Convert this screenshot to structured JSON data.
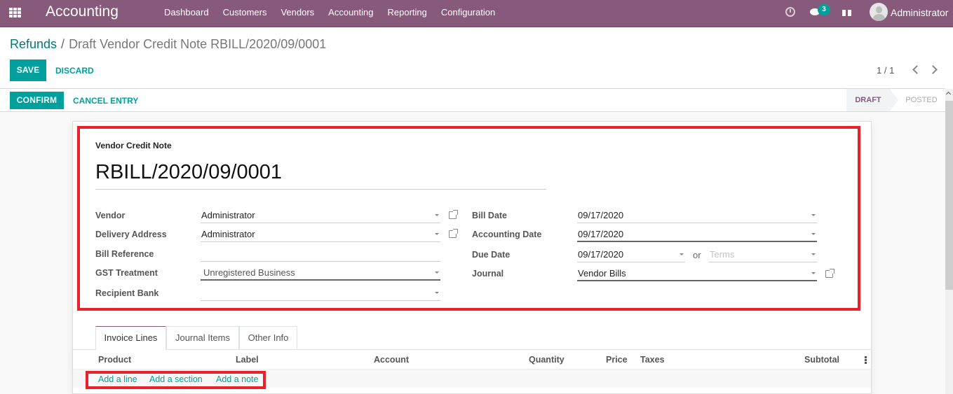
{
  "navbar": {
    "app_title": "Accounting",
    "menu": [
      "Dashboard",
      "Customers",
      "Vendors",
      "Accounting",
      "Reporting",
      "Configuration"
    ],
    "messages_badge": "3",
    "user_name": "Administrator",
    "bg_color": "#875a7b"
  },
  "control_panel": {
    "breadcrumb_parent": "Refunds",
    "breadcrumb_separator": "/",
    "breadcrumb_current": "Draft Vendor Credit Note RBILL/2020/09/0001",
    "save_label": "SAVE",
    "discard_label": "DISCARD",
    "pager_value": "1 / 1"
  },
  "header_buttons": {
    "confirm_label": "CONFIRM",
    "cancel_entry_label": "CANCEL ENTRY"
  },
  "statusbar": {
    "states": [
      "DRAFT",
      "POSTED"
    ],
    "current": "DRAFT"
  },
  "form": {
    "doc_type": "Vendor Credit Note",
    "doc_name": "RBILL/2020/09/0001",
    "left_fields": [
      {
        "label": "Vendor",
        "value": "Administrator"
      },
      {
        "label": "Delivery Address",
        "value": "Administrator"
      },
      {
        "label": "Bill Reference",
        "value": ""
      },
      {
        "label": "GST Treatment",
        "value": "Unregistered Business"
      },
      {
        "label": "Recipient Bank",
        "value": ""
      }
    ],
    "right_fields": [
      {
        "label": "Bill Date",
        "value": "09/17/2020"
      },
      {
        "label": "Accounting Date",
        "value": "09/17/2020"
      },
      {
        "label": "Due Date",
        "value": "09/17/2020"
      },
      {
        "label": "Journal",
        "value": "Vendor Bills"
      }
    ],
    "due_date_or": "or",
    "terms_placeholder": "Terms"
  },
  "tabs": [
    "Invoice Lines",
    "Journal Items",
    "Other Info"
  ],
  "active_tab": "Invoice Lines",
  "invoice_lines": {
    "columns": [
      "Product",
      "Label",
      "Account",
      "Quantity",
      "Price",
      "Taxes",
      "Subtotal"
    ],
    "add_links": [
      "Add a line",
      "Add a section",
      "Add a note"
    ]
  },
  "colors": {
    "primary": "#00a09d",
    "brand": "#875a7b",
    "highlight": "#e8212a"
  }
}
